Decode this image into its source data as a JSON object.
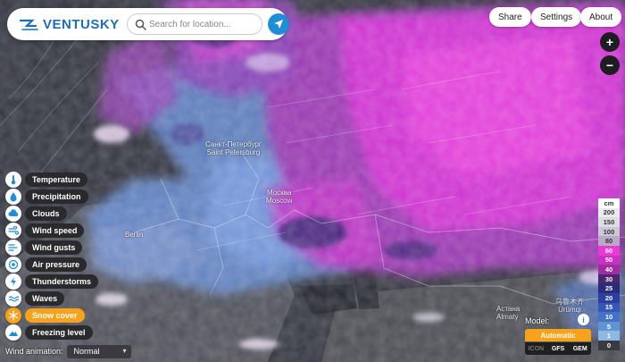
{
  "header": {
    "logo_text": "VENTUSKY",
    "search_placeholder": "Search for location...",
    "share_label": "Share",
    "settings_label": "Settings",
    "about_label": "About"
  },
  "zoom": {
    "in_label": "+",
    "out_label": "−"
  },
  "map_labels": {
    "spb": "Санкт-Петербург",
    "spb_en": "Saint Petersburg",
    "moscow": "Москва",
    "moscow_en": "Moscow",
    "berlin": "Berlin",
    "astana": "Астана",
    "almaty": "Almaty",
    "urumqi": "乌鲁木齐",
    "urumqi_en": "Ürümqi"
  },
  "layers": [
    {
      "label": "Temperature",
      "icon": "thermometer-icon",
      "active": false
    },
    {
      "label": "Precipitation",
      "icon": "raindrop-icon",
      "active": false
    },
    {
      "label": "Clouds",
      "icon": "cloud-icon",
      "active": false
    },
    {
      "label": "Wind speed",
      "icon": "wind-icon",
      "active": false
    },
    {
      "label": "Wind gusts",
      "icon": "wind-gust-icon",
      "active": false
    },
    {
      "label": "Air pressure",
      "icon": "pressure-icon",
      "active": false
    },
    {
      "label": "Thunderstorms",
      "icon": "lightning-icon",
      "active": false
    },
    {
      "label": "Waves",
      "icon": "waves-icon",
      "active": false
    },
    {
      "label": "Snow cover",
      "icon": "snowflake-icon",
      "active": true
    },
    {
      "label": "Freezing level",
      "icon": "freezing-level-icon",
      "active": false
    }
  ],
  "wind_animation": {
    "label": "Wind animation:",
    "value": "Normal"
  },
  "model": {
    "label": "Model:",
    "info": "i",
    "selected": "Automatic",
    "options": [
      "ICON",
      "GFS",
      "GEM"
    ]
  },
  "legend": {
    "unit": "cm",
    "entries": [
      {
        "value": "200",
        "color": "#e9e9ee",
        "text": "#333333"
      },
      {
        "value": "150",
        "color": "#dcdce4",
        "text": "#333333"
      },
      {
        "value": "100",
        "color": "#cdc5d8",
        "text": "#333333"
      },
      {
        "value": "80",
        "color": "#b9a9c6",
        "text": "#333333"
      },
      {
        "value": "60",
        "color": "#e93ad8",
        "text": "#ffffff"
      },
      {
        "value": "50",
        "color": "#cc2fc2",
        "text": "#ffffff"
      },
      {
        "value": "40",
        "color": "#a02ba2",
        "text": "#ffffff"
      },
      {
        "value": "30",
        "color": "#4b2670",
        "text": "#ffffff"
      },
      {
        "value": "25",
        "color": "#2a2b7a",
        "text": "#ffffff"
      },
      {
        "value": "20",
        "color": "#2c3fa0",
        "text": "#ffffff"
      },
      {
        "value": "15",
        "color": "#3657b8",
        "text": "#ffffff"
      },
      {
        "value": "10",
        "color": "#4472c6",
        "text": "#ffffff"
      },
      {
        "value": "5",
        "color": "#5f93d4",
        "text": "#ffffff"
      },
      {
        "value": "1",
        "color": "#8cb8e2",
        "text": "#ffffff"
      },
      {
        "value": "0",
        "color": "#3a3a40",
        "text": "#ffffff"
      }
    ]
  }
}
